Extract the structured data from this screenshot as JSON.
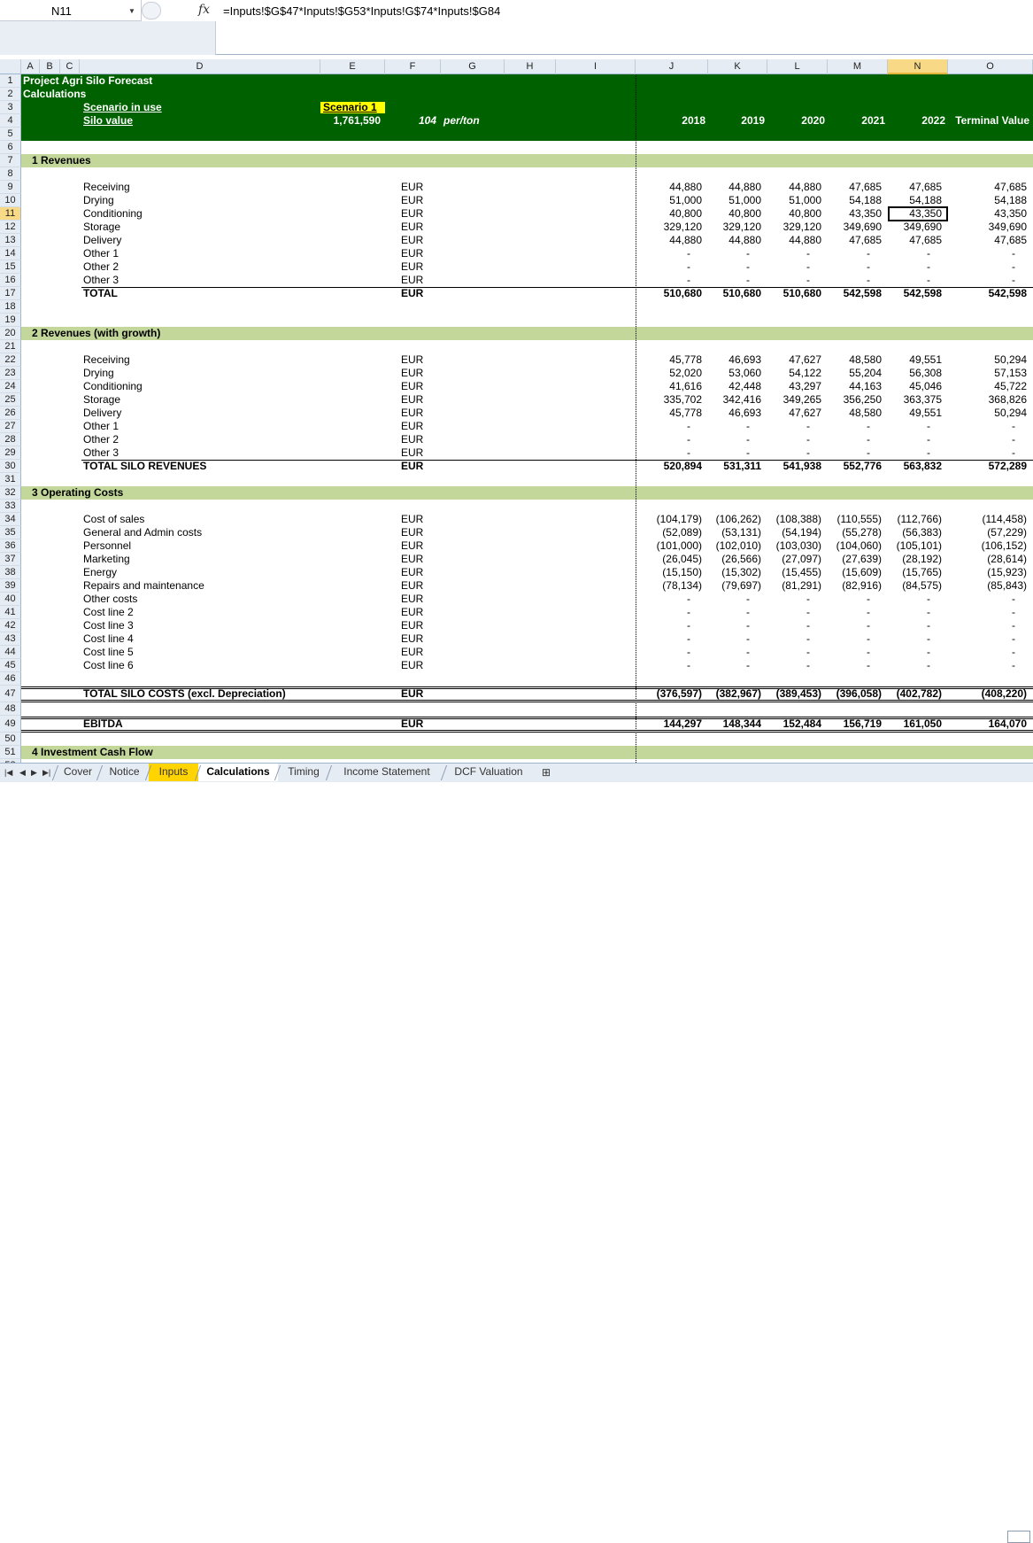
{
  "formula_bar": {
    "name_box": "N11",
    "fx": "fx",
    "formula": "=Inputs!$G$47*Inputs!$G53*Inputs!G$74*Inputs!$G84"
  },
  "columns": [
    "A",
    "B",
    "C",
    "D",
    "E",
    "F",
    "G",
    "H",
    "I",
    "J",
    "K",
    "L",
    "M",
    "N",
    "O"
  ],
  "selected_column": "N",
  "selected_row": "11",
  "header": {
    "title": "Project Agri Silo Forecast",
    "subtitle": "Calculations",
    "scenario_label": "Scenario in use",
    "scenario_value": "Scenario 1",
    "silo_label": "Silo value",
    "silo_value": "1,761,590",
    "per_ton_value": "104",
    "per_ton_label": "per/ton",
    "years": [
      "2018",
      "2019",
      "2020",
      "2021",
      "2022"
    ],
    "terminal": "Terminal Value"
  },
  "sections": {
    "s1": "1  Revenues",
    "s2": "2  Revenues (with growth)",
    "s3": "3  Operating Costs",
    "s4": "4  Investment Cash Flow"
  },
  "rows": [
    {
      "r": "9",
      "label": "Receiving",
      "unit": "EUR",
      "vals": [
        "44,880",
        "44,880",
        "44,880",
        "47,685",
        "47,685",
        "47,685"
      ]
    },
    {
      "r": "10",
      "label": "Drying",
      "unit": "EUR",
      "vals": [
        "51,000",
        "51,000",
        "51,000",
        "54,188",
        "54,188",
        "54,188"
      ]
    },
    {
      "r": "11",
      "label": "Conditioning",
      "unit": "EUR",
      "vals": [
        "40,800",
        "40,800",
        "40,800",
        "43,350",
        "43,350",
        "43,350"
      ]
    },
    {
      "r": "12",
      "label": "Storage",
      "unit": "EUR",
      "vals": [
        "329,120",
        "329,120",
        "329,120",
        "349,690",
        "349,690",
        "349,690"
      ]
    },
    {
      "r": "13",
      "label": "Delivery",
      "unit": "EUR",
      "vals": [
        "44,880",
        "44,880",
        "44,880",
        "47,685",
        "47,685",
        "47,685"
      ]
    },
    {
      "r": "14",
      "label": "Other 1",
      "unit": "EUR",
      "vals": [
        "-",
        "-",
        "-",
        "-",
        "-",
        "-"
      ]
    },
    {
      "r": "15",
      "label": "Other 2",
      "unit": "EUR",
      "vals": [
        "-",
        "-",
        "-",
        "-",
        "-",
        "-"
      ]
    },
    {
      "r": "16",
      "label": "Other 3",
      "unit": "EUR",
      "vals": [
        "-",
        "-",
        "-",
        "-",
        "-",
        "-"
      ]
    },
    {
      "r": "17",
      "label": "TOTAL",
      "unit": "EUR",
      "bold": true,
      "vals": [
        "510,680",
        "510,680",
        "510,680",
        "542,598",
        "542,598",
        "542,598"
      ]
    },
    {
      "r": "22",
      "label": "Receiving",
      "unit": "EUR",
      "vals": [
        "45,778",
        "46,693",
        "47,627",
        "48,580",
        "49,551",
        "50,294"
      ]
    },
    {
      "r": "23",
      "label": "Drying",
      "unit": "EUR",
      "vals": [
        "52,020",
        "53,060",
        "54,122",
        "55,204",
        "56,308",
        "57,153"
      ]
    },
    {
      "r": "24",
      "label": "Conditioning",
      "unit": "EUR",
      "vals": [
        "41,616",
        "42,448",
        "43,297",
        "44,163",
        "45,046",
        "45,722"
      ]
    },
    {
      "r": "25",
      "label": "Storage",
      "unit": "EUR",
      "vals": [
        "335,702",
        "342,416",
        "349,265",
        "356,250",
        "363,375",
        "368,826"
      ]
    },
    {
      "r": "26",
      "label": "Delivery",
      "unit": "EUR",
      "vals": [
        "45,778",
        "46,693",
        "47,627",
        "48,580",
        "49,551",
        "50,294"
      ]
    },
    {
      "r": "27",
      "label": "Other 1",
      "unit": "EUR",
      "vals": [
        "-",
        "-",
        "-",
        "-",
        "-",
        "-"
      ]
    },
    {
      "r": "28",
      "label": "Other 2",
      "unit": "EUR",
      "vals": [
        "-",
        "-",
        "-",
        "-",
        "-",
        "-"
      ]
    },
    {
      "r": "29",
      "label": "Other 3",
      "unit": "EUR",
      "vals": [
        "-",
        "-",
        "-",
        "-",
        "-",
        "-"
      ]
    },
    {
      "r": "30",
      "label": "TOTAL SILO REVENUES",
      "unit": "EUR",
      "bold": true,
      "vals": [
        "520,894",
        "531,311",
        "541,938",
        "552,776",
        "563,832",
        "572,289"
      ]
    },
    {
      "r": "34",
      "label": "Cost of sales",
      "unit": "EUR",
      "vals": [
        "(104,179)",
        "(106,262)",
        "(108,388)",
        "(110,555)",
        "(112,766)",
        "(114,458)"
      ]
    },
    {
      "r": "35",
      "label": "General and Admin costs",
      "unit": "EUR",
      "vals": [
        "(52,089)",
        "(53,131)",
        "(54,194)",
        "(55,278)",
        "(56,383)",
        "(57,229)"
      ]
    },
    {
      "r": "36",
      "label": "Personnel",
      "unit": "EUR",
      "vals": [
        "(101,000)",
        "(102,010)",
        "(103,030)",
        "(104,060)",
        "(105,101)",
        "(106,152)"
      ]
    },
    {
      "r": "37",
      "label": "Marketing",
      "unit": "EUR",
      "vals": [
        "(26,045)",
        "(26,566)",
        "(27,097)",
        "(27,639)",
        "(28,192)",
        "(28,614)"
      ]
    },
    {
      "r": "38",
      "label": "Energy",
      "unit": "EUR",
      "vals": [
        "(15,150)",
        "(15,302)",
        "(15,455)",
        "(15,609)",
        "(15,765)",
        "(15,923)"
      ]
    },
    {
      "r": "39",
      "label": "Repairs and maintenance",
      "unit": "EUR",
      "vals": [
        "(78,134)",
        "(79,697)",
        "(81,291)",
        "(82,916)",
        "(84,575)",
        "(85,843)"
      ]
    },
    {
      "r": "40",
      "label": "Other costs",
      "unit": "EUR",
      "vals": [
        "-",
        "-",
        "-",
        "-",
        "-",
        "-"
      ]
    },
    {
      "r": "41",
      "label": "Cost line 2",
      "unit": "EUR",
      "vals": [
        "-",
        "-",
        "-",
        "-",
        "-",
        "-"
      ]
    },
    {
      "r": "42",
      "label": "Cost line 3",
      "unit": "EUR",
      "vals": [
        "-",
        "-",
        "-",
        "-",
        "-",
        "-"
      ]
    },
    {
      "r": "43",
      "label": "Cost line 4",
      "unit": "EUR",
      "vals": [
        "-",
        "-",
        "-",
        "-",
        "-",
        "-"
      ]
    },
    {
      "r": "44",
      "label": "Cost line 5",
      "unit": "EUR",
      "vals": [
        "-",
        "-",
        "-",
        "-",
        "-",
        "-"
      ]
    },
    {
      "r": "45",
      "label": "Cost line 6",
      "unit": "EUR",
      "vals": [
        "-",
        "-",
        "-",
        "-",
        "-",
        "-"
      ]
    },
    {
      "r": "47",
      "label": "TOTAL SILO COSTS (excl. Depreciation)",
      "unit": "EUR",
      "bold": true,
      "vals": [
        "(376,597)",
        "(382,967)",
        "(389,453)",
        "(396,058)",
        "(402,782)",
        "(408,220)"
      ]
    },
    {
      "r": "49",
      "label": "EBITDA",
      "unit": "EUR",
      "bold": true,
      "vals": [
        "144,297",
        "148,344",
        "152,484",
        "156,719",
        "161,050",
        "164,070"
      ]
    }
  ],
  "row_numbers": [
    "1",
    "2",
    "3",
    "4",
    "5",
    "6",
    "7",
    "8",
    "9",
    "10",
    "11",
    "12",
    "13",
    "14",
    "15",
    "16",
    "17",
    "18",
    "19",
    "20",
    "21",
    "22",
    "23",
    "24",
    "25",
    "26",
    "27",
    "28",
    "29",
    "30",
    "31",
    "32",
    "33",
    "34",
    "35",
    "36",
    "37",
    "38",
    "39",
    "40",
    "41",
    "42",
    "43",
    "44",
    "45",
    "46",
    "47",
    "48",
    "49",
    "50",
    "51",
    "52"
  ],
  "tabs": [
    "Cover",
    "Notice",
    "Inputs",
    "Calculations",
    "Timing",
    "Income Statement",
    "DCF Valuation"
  ],
  "active_tab": "Calculations",
  "colored_tab": "Inputs",
  "colors": {
    "header_green": "#006100",
    "section_band": "#c4d79b",
    "scenario_yellow": "#ffff00",
    "inputs_tab": "#ffd400"
  }
}
